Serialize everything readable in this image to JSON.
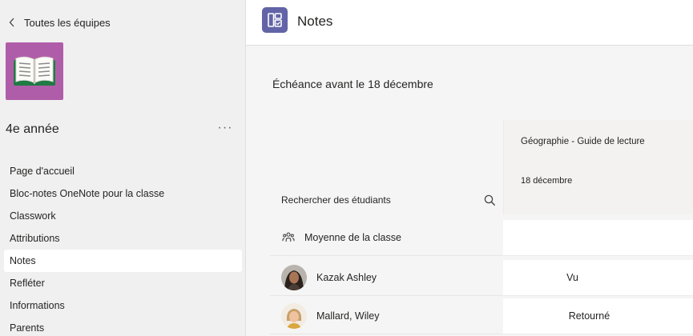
{
  "sidebar": {
    "back_label": "Toutes les équipes",
    "team_name": "4e année",
    "more_label": "···",
    "items": [
      {
        "label": "Page d'accueil"
      },
      {
        "label": "Bloc-notes OneNote pour la classe"
      },
      {
        "label": "Classwork"
      },
      {
        "label": "Attributions"
      },
      {
        "label": "Notes",
        "active": true
      },
      {
        "label": "Refléter"
      },
      {
        "label": "Informations"
      },
      {
        "label": "Parents"
      }
    ]
  },
  "header": {
    "title": "Notes",
    "icon": "grades-icon",
    "accent": "#6264a7"
  },
  "main": {
    "due_label": "Échéance avant le 18 décembre",
    "search_placeholder": "Rechercher des étudiants",
    "assignment": {
      "title": "Géographie - Guide de lecture",
      "date": "18 décembre"
    },
    "class_average_label": "Moyenne de la classe",
    "students": [
      {
        "name": "Kazak Ashley",
        "status": "Vu"
      },
      {
        "name": "Mallard, Wiley",
        "status": "Retourné"
      }
    ]
  },
  "colors": {
    "team_tile": "#b05da9",
    "sidebar_bg": "#f0f0f0",
    "main_bg": "#f5f5f5"
  }
}
